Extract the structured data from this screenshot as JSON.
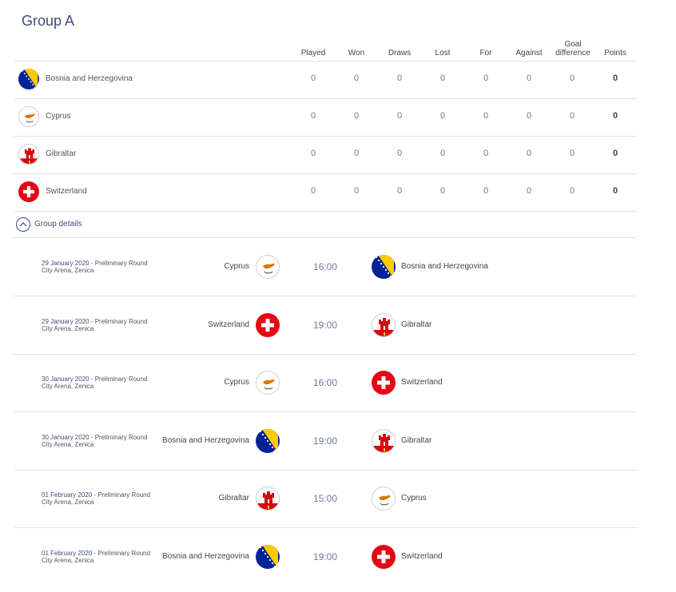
{
  "group": {
    "title": "Group A"
  },
  "table": {
    "columns": [
      "Played",
      "Won",
      "Draws",
      "Lost",
      "For",
      "Against",
      "Goal difference",
      "Points"
    ],
    "rows": [
      {
        "team": "Bosnia and Herzegovina",
        "flag": "bih-flag-icon",
        "played": "0",
        "won": "0",
        "draws": "0",
        "lost": "0",
        "for": "0",
        "against": "0",
        "gd": "0",
        "points": "0"
      },
      {
        "team": "Cyprus",
        "flag": "cyprus-flag-icon",
        "played": "0",
        "won": "0",
        "draws": "0",
        "lost": "0",
        "for": "0",
        "against": "0",
        "gd": "0",
        "points": "0"
      },
      {
        "team": "Gibraltar",
        "flag": "gibraltar-flag-icon",
        "played": "0",
        "won": "0",
        "draws": "0",
        "lost": "0",
        "for": "0",
        "against": "0",
        "gd": "0",
        "points": "0"
      },
      {
        "team": "Switzerland",
        "flag": "switzerland-flag-icon",
        "played": "0",
        "won": "0",
        "draws": "0",
        "lost": "0",
        "for": "0",
        "against": "0",
        "gd": "0",
        "points": "0"
      }
    ]
  },
  "details": {
    "label": "Group details",
    "icon": "chevron-up-icon"
  },
  "matches": [
    {
      "date": "29 January 2020",
      "round": " - Preliminary Round",
      "venue": "City Arena, Zenica",
      "home": "Cyprus",
      "time": "16:00",
      "away": "Bosnia and Herzegovina"
    },
    {
      "date": "29 January 2020",
      "round": " - Preliminary Round",
      "venue": "City Arena, Zenica",
      "home": "Switzerland",
      "time": "19:00",
      "away": "Gibraltar"
    },
    {
      "date": "30 January 2020",
      "round": " - Preliminary Round",
      "venue": "City Arena, Zenica",
      "home": "Cyprus",
      "time": "16:00",
      "away": "Switzerland"
    },
    {
      "date": "30 January 2020",
      "round": " - Preliminary Round",
      "venue": "City Arena, Zenica",
      "home": "Bosnia and Herzegovina",
      "time": "19:00",
      "away": "Gibraltar"
    },
    {
      "date": "01 February 2020",
      "round": " - Preliminary Round",
      "venue": "City Arena, Zenica",
      "home": "Gibraltar",
      "time": "15:00",
      "away": "Cyprus"
    },
    {
      "date": "01 February 2020",
      "round": " - Preliminary Round",
      "venue": "City Arena, Zenica",
      "home": "Bosnia and Herzegovina",
      "time": "19:00",
      "away": "Switzerland"
    }
  ],
  "colors": {
    "accent": "#3b4f7a",
    "swiss_red": "#e30613",
    "bih_blue": "#002395",
    "bih_yellow": "#fecb00",
    "cyprus_copper": "#d57800",
    "cyprus_olive": "#4e5b31"
  }
}
